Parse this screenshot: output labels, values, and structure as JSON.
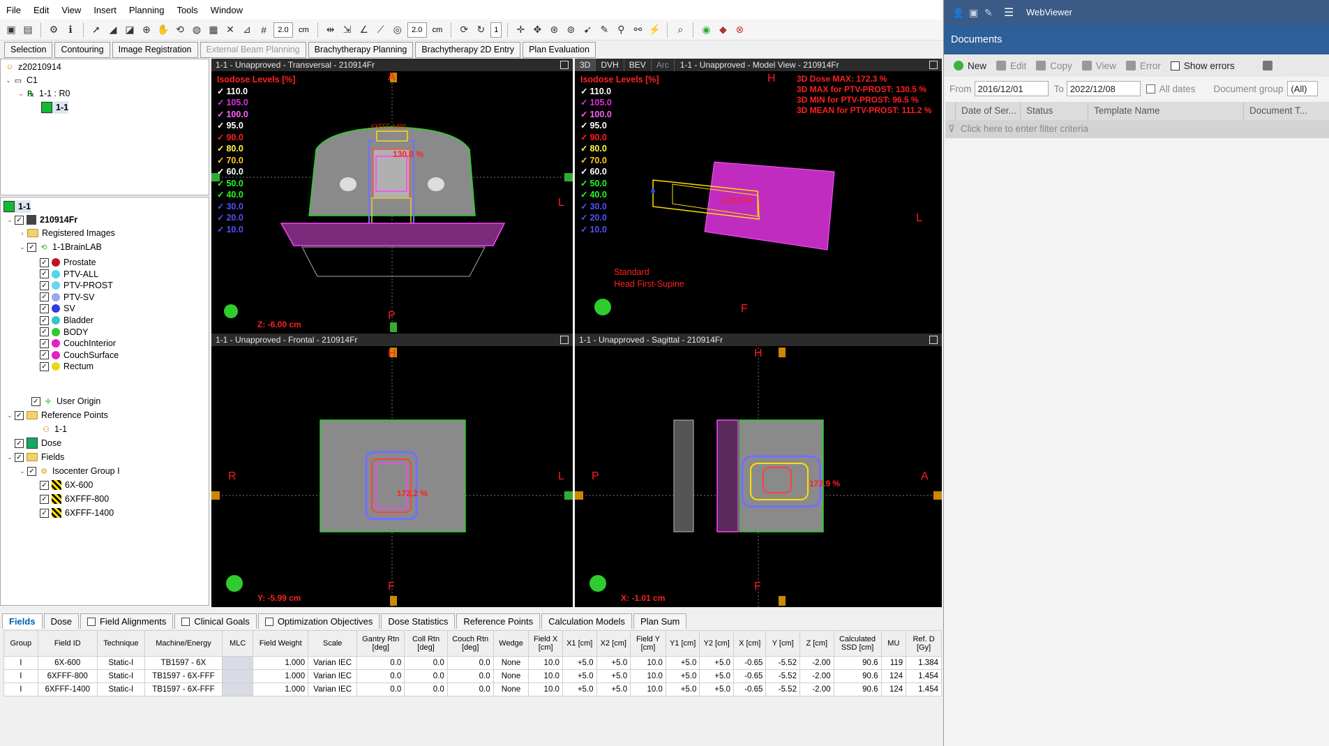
{
  "menu": [
    "File",
    "Edit",
    "View",
    "Insert",
    "Planning",
    "Tools",
    "Window"
  ],
  "toolbar": {
    "thickness1": "2.0",
    "unit1": "cm",
    "thickness2": "2.0",
    "unit2": "cm",
    "count": "1"
  },
  "workspaces": [
    {
      "label": "Selection",
      "disabled": false
    },
    {
      "label": "Contouring",
      "disabled": false
    },
    {
      "label": "Image Registration",
      "disabled": false
    },
    {
      "label": "External Beam Planning",
      "disabled": true
    },
    {
      "label": "Brachytherapy Planning",
      "disabled": false
    },
    {
      "label": "Brachytherapy 2D Entry",
      "disabled": false
    },
    {
      "label": "Plan Evaluation",
      "disabled": false
    }
  ],
  "tree1": {
    "patient": "z20210914",
    "course": "C1",
    "plan": "1-1 : R0",
    "planitem": "1-1"
  },
  "tree2": {
    "root": "1-1",
    "image": "210914Fr",
    "registered": "Registered Images",
    "structset": "1-1BrainLAB",
    "structures": [
      {
        "name": "Prostate",
        "color": "#c0141e"
      },
      {
        "name": "PTV-ALL",
        "color": "#4fd6e8"
      },
      {
        "name": "PTV-PROST",
        "color": "#6ad6f0"
      },
      {
        "name": "PTV-SV",
        "color": "#9fa6f0"
      },
      {
        "name": "SV",
        "color": "#2b3be6"
      },
      {
        "name": "Bladder",
        "color": "#31c7c2"
      },
      {
        "name": "BODY",
        "color": "#2ecc2e"
      },
      {
        "name": "CouchInterior",
        "color": "#e81ec9"
      },
      {
        "name": "CouchSurface",
        "color": "#e81ec9"
      },
      {
        "name": "Rectum",
        "color": "#e8d81e"
      }
    ],
    "origin": "User Origin",
    "refpoints": "Reference Points",
    "refpoint": "1-1",
    "dose": "Dose",
    "fields": "Fields",
    "isogroup": "Isocenter Group I",
    "fieldlist": [
      "6X-600",
      "6XFFF-800",
      "6XFFF-1400"
    ]
  },
  "isodose": {
    "title": "Isodose Levels [%]",
    "levels": [
      {
        "v": "110.0",
        "c": "#ffffff"
      },
      {
        "v": "105.0",
        "c": "#e030e0"
      },
      {
        "v": "100.0",
        "c": "#ff60ff"
      },
      {
        "v": "95.0",
        "c": "#ffffff"
      },
      {
        "v": "90.0",
        "c": "#ff2020"
      },
      {
        "v": "80.0",
        "c": "#ffff40"
      },
      {
        "v": "70.0",
        "c": "#ffd020"
      },
      {
        "v": "60.0",
        "c": "#ffffff"
      },
      {
        "v": "50.0",
        "c": "#20ff20"
      },
      {
        "v": "40.0",
        "c": "#20ff20"
      },
      {
        "v": "30.0",
        "c": "#5050ff"
      },
      {
        "v": "20.0",
        "c": "#5050ff"
      },
      {
        "v": "10.0",
        "c": "#5050ff"
      }
    ]
  },
  "views": {
    "trans": {
      "title": "1-1 - Unapproved - Transversal - 210914Fr",
      "A": "A",
      "P": "P",
      "L": "L",
      "z": "Z: -6.00 cm",
      "dose": "130.0 %",
      "beam": "6XFFF-1400"
    },
    "model": {
      "tabs": [
        "3D",
        "DVH",
        "BEV",
        "Arc"
      ],
      "title": "1-1 - Unapproved - Model View - 210914Fr",
      "H": "H",
      "L": "L",
      "F": "F",
      "stats": [
        "3D Dose MAX: 172.3 %",
        "3D MAX for PTV-PROST: 130.5 %",
        "3D MIN for PTV-PROST: 96.5 %",
        "3D MEAN for PTV-PROST: 111.2 %"
      ],
      "dose": "172.3 %",
      "orient1": "Standard",
      "orient2": "Head First-Supine"
    },
    "front": {
      "title": "1-1 - Unapproved - Frontal - 210914Fr",
      "H": "H",
      "F": "F",
      "R": "R",
      "L": "L",
      "y": "Y: -5.99 cm",
      "dose": "172.2 %",
      "beam": "6XFFF-800"
    },
    "sag": {
      "title": "1-1 - Unapproved - Sagittal - 210914Fr",
      "H": "H",
      "F": "F",
      "P": "P",
      "A": "A",
      "x": "X: -1.01 cm",
      "dose": "172.9 %",
      "beam": "6XFFF-600"
    }
  },
  "bottomtabs": [
    {
      "label": "Fields",
      "sel": true,
      "cb": false
    },
    {
      "label": "Dose",
      "sel": false,
      "cb": false
    },
    {
      "label": "Field Alignments",
      "sel": false,
      "cb": true
    },
    {
      "label": "Clinical Goals",
      "sel": false,
      "cb": true
    },
    {
      "label": "Optimization Objectives",
      "sel": false,
      "cb": true
    },
    {
      "label": "Dose Statistics",
      "sel": false,
      "cb": false
    },
    {
      "label": "Reference Points",
      "sel": false,
      "cb": false
    },
    {
      "label": "Calculation Models",
      "sel": false,
      "cb": false
    },
    {
      "label": "Plan Sum",
      "sel": false,
      "cb": false
    }
  ],
  "table": {
    "headers": [
      "Group",
      "Field ID",
      "Technique",
      "Machine/Energy",
      "MLC",
      "Field Weight",
      "Scale",
      "Gantry Rtn [deg]",
      "Coll Rtn [deg]",
      "Couch Rtn [deg]",
      "Wedge",
      "Field X [cm]",
      "X1 [cm]",
      "X2 [cm]",
      "Field Y [cm]",
      "Y1 [cm]",
      "Y2 [cm]",
      "X [cm]",
      "Y [cm]",
      "Z [cm]",
      "Calculated SSD [cm]",
      "MU",
      "Ref. D [Gy]"
    ],
    "rows": [
      [
        "I",
        "6X-600",
        "Static-I",
        "TB1597 - 6X",
        "",
        "1.000",
        "Varian IEC",
        "0.0",
        "0.0",
        "0.0",
        "None",
        "10.0",
        "+5.0",
        "+5.0",
        "10.0",
        "+5.0",
        "+5.0",
        "-0.65",
        "-5.52",
        "-2.00",
        "90.6",
        "119",
        "1.384"
      ],
      [
        "I",
        "6XFFF-800",
        "Static-I",
        "TB1597 - 6X-FFF",
        "",
        "1.000",
        "Varian IEC",
        "0.0",
        "0.0",
        "0.0",
        "None",
        "10.0",
        "+5.0",
        "+5.0",
        "10.0",
        "+5.0",
        "+5.0",
        "-0.65",
        "-5.52",
        "-2.00",
        "90.6",
        "124",
        "1.454"
      ],
      [
        "I",
        "6XFFF-1400",
        "Static-I",
        "TB1597 - 6X-FFF",
        "",
        "1.000",
        "Varian IEC",
        "0.0",
        "0.0",
        "0.0",
        "None",
        "10.0",
        "+5.0",
        "+5.0",
        "10.0",
        "+5.0",
        "+5.0",
        "-0.65",
        "-5.52",
        "-2.00",
        "90.6",
        "124",
        "1.454"
      ]
    ]
  },
  "webviewer": {
    "title": "WebViewer",
    "section": "Documents",
    "tools": [
      "New",
      "Edit",
      "Copy",
      "View",
      "Error",
      "Show errors"
    ],
    "from_label": "From",
    "from": "2016/12/01",
    "to_label": "To",
    "to": "2022/12/08",
    "alldates": "All dates",
    "docgroup": "Document group",
    "docgroup_val": "(All)",
    "columns": [
      "Date of Ser...",
      "Status",
      "Template Name",
      "Document T..."
    ],
    "filter": "Click here to enter filter criteria"
  }
}
